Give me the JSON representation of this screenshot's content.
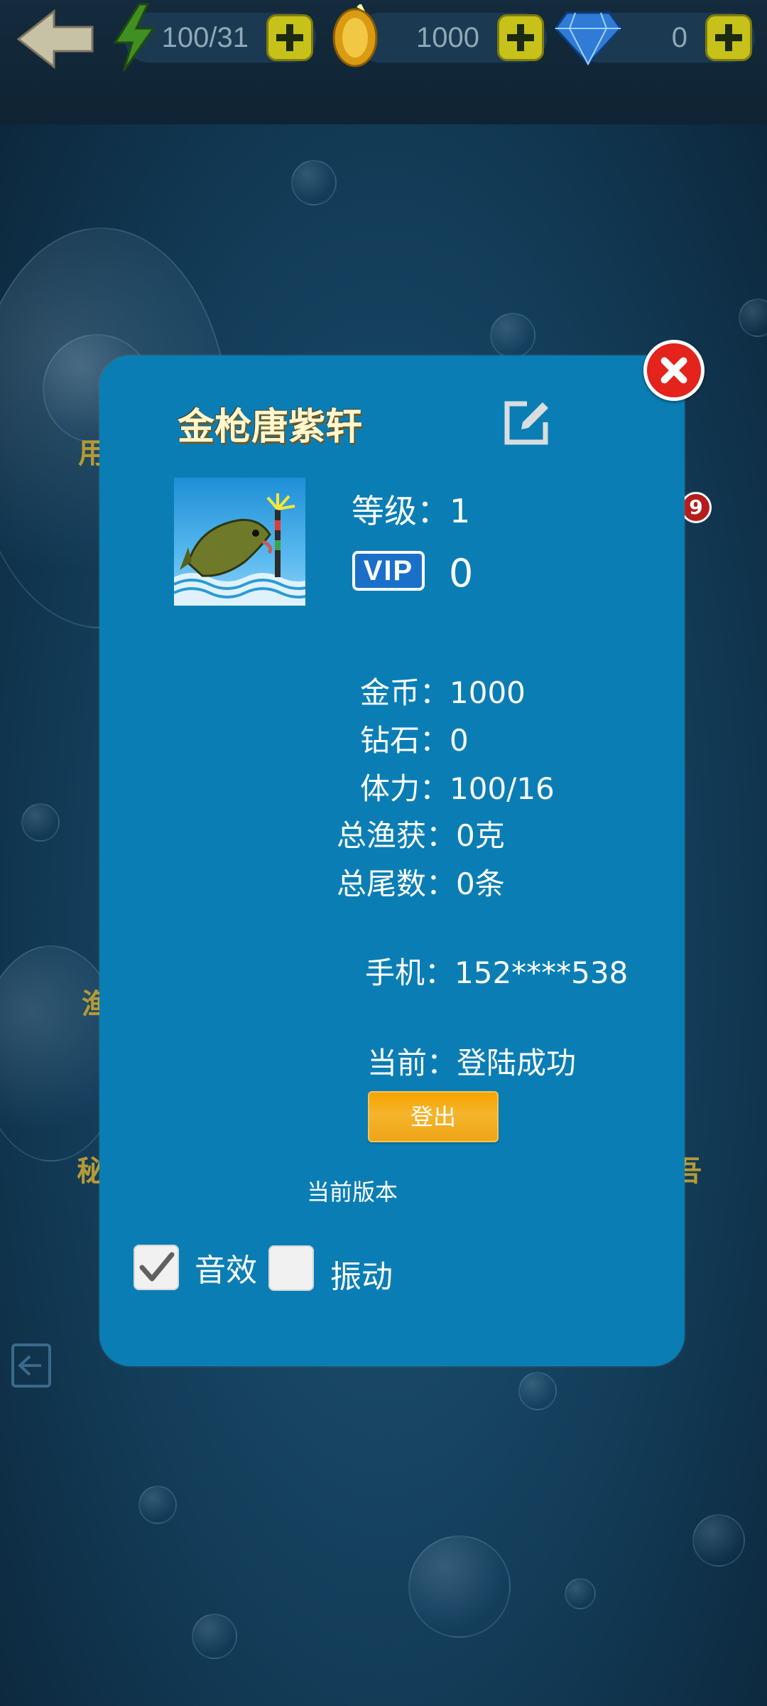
{
  "hud": {
    "stamina": "100/31",
    "coins": "1000",
    "diamonds": "0",
    "icons": [
      "back-arrow-icon",
      "lightning-icon",
      "coin-icon",
      "diamond-icon",
      "plus-icon"
    ]
  },
  "background": {
    "labels": [
      "用",
      "渔",
      "秘",
      "吾"
    ],
    "badge_count": "9"
  },
  "modal": {
    "player_name": "金枪唐紫轩",
    "level": "等级：1",
    "vip_label": "VIP",
    "vip_level": "0",
    "stats": {
      "gold": "金币：1000",
      "diamond": "钻石：0",
      "stamina": "体力：100/16",
      "total_weight": "总渔获：0克",
      "total_count": "总尾数：0条",
      "phone": "手机：152****538",
      "status": "当前：登陆成功"
    },
    "logout_label": "登出",
    "version_label": "当前版本",
    "sound": {
      "label": "音效",
      "checked": true
    },
    "vibration": {
      "label": "振动",
      "checked": false
    }
  },
  "colors": {
    "modal_bg": "#0a7eb4",
    "close_red": "#e3231c",
    "logout_orange": "#f4b52c",
    "hud_plus": "#c6c21a"
  }
}
